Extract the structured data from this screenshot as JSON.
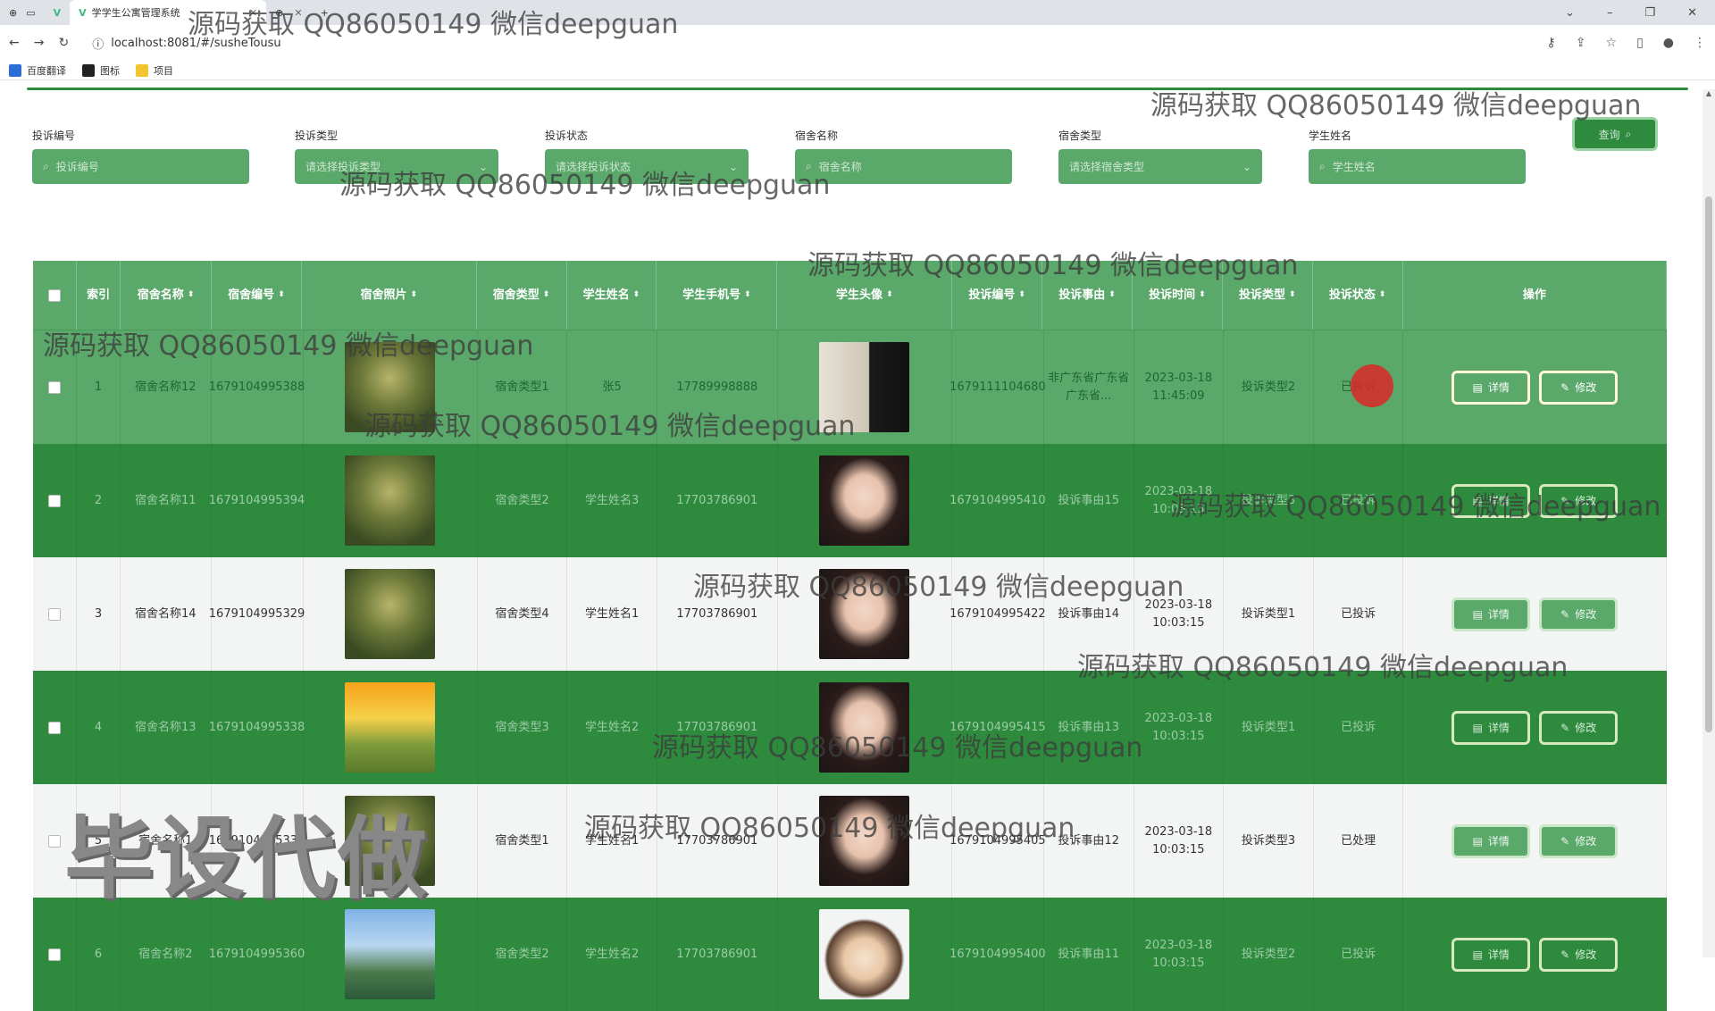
{
  "browser": {
    "tab_active_title": "学学生公寓管理系统",
    "tab_second_title": "",
    "url": "localhost:8081/#/susheTousu",
    "bookmarks": [
      "百度翻译",
      "图标",
      "项目"
    ]
  },
  "search": {
    "fields": [
      {
        "label": "投诉编号",
        "placeholder": "投诉编号",
        "type": "input"
      },
      {
        "label": "投诉类型",
        "placeholder": "请选择投诉类型",
        "type": "select"
      },
      {
        "label": "投诉状态",
        "placeholder": "请选择投诉状态",
        "type": "select"
      },
      {
        "label": "宿舍名称",
        "placeholder": "宿舍名称",
        "type": "input"
      },
      {
        "label": "宿舍类型",
        "placeholder": "请选择宿舍类型",
        "type": "select"
      },
      {
        "label": "学生姓名",
        "placeholder": "学生姓名",
        "type": "input"
      }
    ],
    "query_button": "查询"
  },
  "table": {
    "headers": [
      "索引",
      "宿舍名称",
      "宿舍编号",
      "宿舍照片",
      "宿舍类型",
      "学生姓名",
      "学生手机号",
      "学生头像",
      "投诉编号",
      "投诉事由",
      "投诉时间",
      "投诉类型",
      "投诉状态",
      "操作"
    ],
    "rows": [
      {
        "index": "1",
        "name": "宿舍名称12",
        "no": "1679104995388",
        "type": "宿舍类型1",
        "student": "张5",
        "phone": "17789998888",
        "complaint_no": "1679111104680",
        "reason": "非广东省广东省广东省...",
        "time": "2023-03-18 11:45:09",
        "ctype": "投诉类型2",
        "status": "已投诉",
        "photo": "forest",
        "avatar": "man"
      },
      {
        "index": "2",
        "name": "宿舍名称11",
        "no": "1679104995394",
        "type": "宿舍类型2",
        "student": "学生姓名3",
        "phone": "17703786901",
        "complaint_no": "1679104995410",
        "reason": "投诉事由15",
        "time": "2023-03-18 10:03:15",
        "ctype": "投诉类型3",
        "status": "已投诉",
        "photo": "forest",
        "avatar": "girl"
      },
      {
        "index": "3",
        "name": "宿舍名称14",
        "no": "1679104995329",
        "type": "宿舍类型4",
        "student": "学生姓名1",
        "phone": "17703786901",
        "complaint_no": "1679104995422",
        "reason": "投诉事由14",
        "time": "2023-03-18 10:03:15",
        "ctype": "投诉类型1",
        "status": "已投诉",
        "photo": "forest",
        "avatar": "girl"
      },
      {
        "index": "4",
        "name": "宿舍名称13",
        "no": "1679104995338",
        "type": "宿舍类型3",
        "student": "学生姓名2",
        "phone": "17703786901",
        "complaint_no": "1679104995415",
        "reason": "投诉事由13",
        "time": "2023-03-18 10:03:15",
        "ctype": "投诉类型1",
        "status": "已投诉",
        "photo": "sunset",
        "avatar": "girl"
      },
      {
        "index": "5",
        "name": "宿舍名称1",
        "no": "1679104995338",
        "type": "宿舍类型1",
        "student": "学生姓名1",
        "phone": "17703786901",
        "complaint_no": "1679104995405",
        "reason": "投诉事由12",
        "time": "2023-03-18 10:03:15",
        "ctype": "投诉类型3",
        "status": "已处理",
        "photo": "forest",
        "avatar": "girl"
      },
      {
        "index": "6",
        "name": "宿舍名称2",
        "no": "1679104995360",
        "type": "宿舍类型2",
        "student": "学生姓名2",
        "phone": "17703786901",
        "complaint_no": "1679104995400",
        "reason": "投诉事由11",
        "time": "2023-03-18 10:03:15",
        "ctype": "投诉类型2",
        "status": "已投诉",
        "photo": "mountain",
        "avatar": "cartoon"
      }
    ],
    "detail_label": "详情",
    "edit_label": "修改"
  },
  "watermarks": {
    "qq_text": "源码获取 QQ86050149 微信deepguan",
    "big_text": "毕设代做"
  },
  "colors": {
    "primary": "#2e8b3e",
    "light": "#5aa86a",
    "cursor": "#dc2828"
  }
}
